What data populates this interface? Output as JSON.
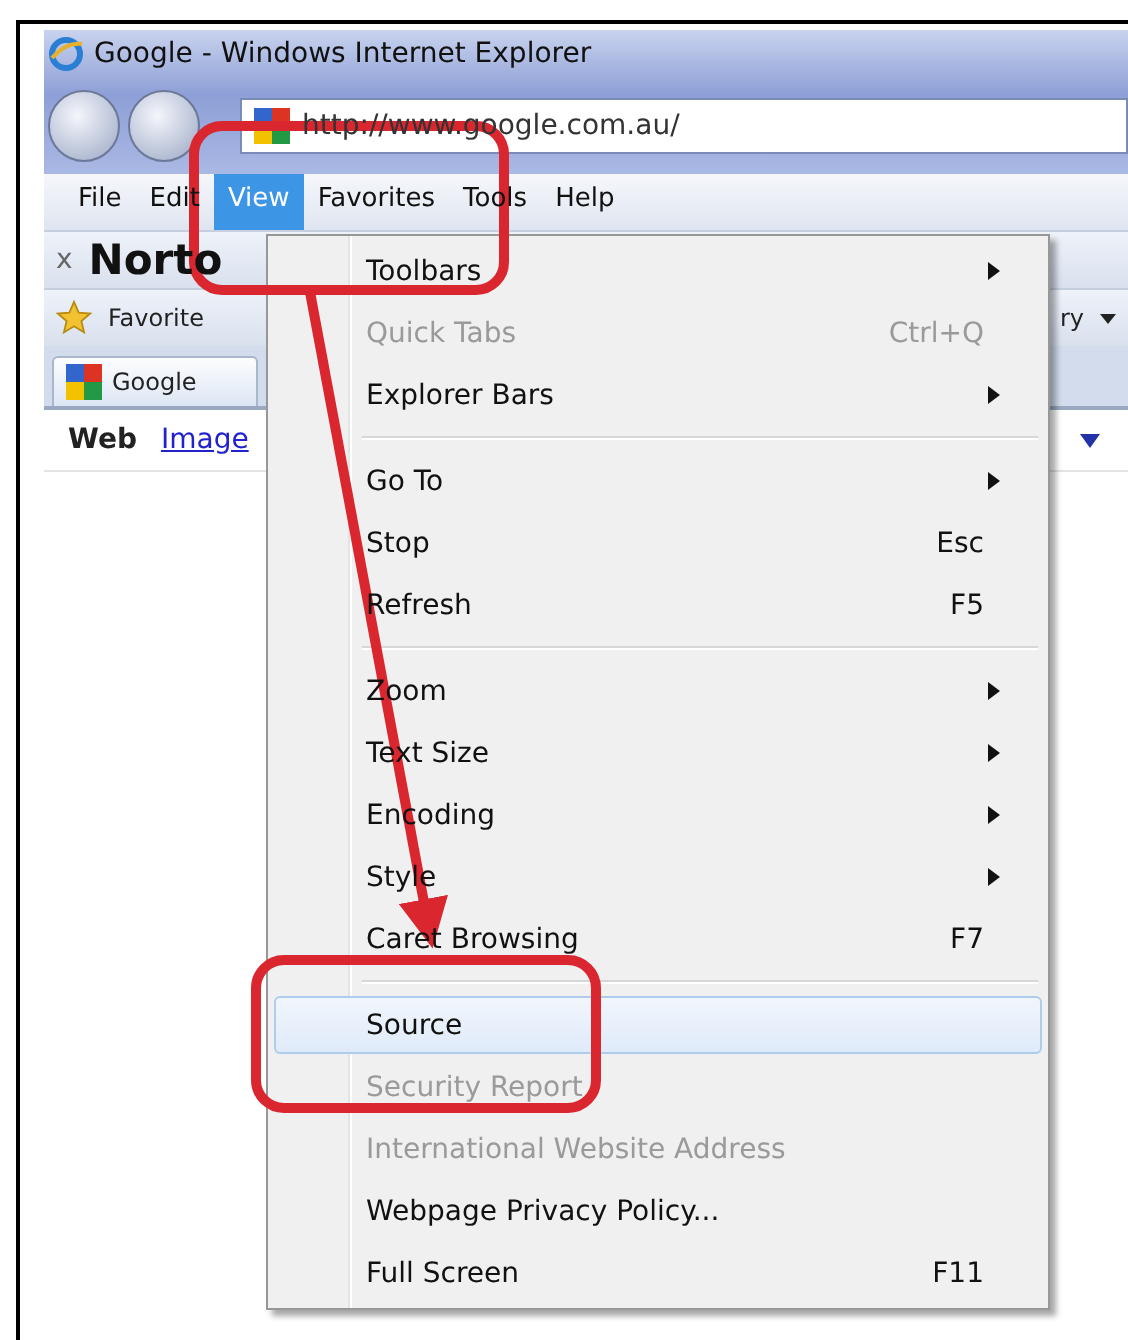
{
  "window": {
    "title": "Google - Windows Internet Explorer"
  },
  "address_bar": {
    "url": "http://www.google.com.au/"
  },
  "menu_bar": [
    {
      "label": "File",
      "selected": false
    },
    {
      "label": "Edit",
      "selected": false
    },
    {
      "label": "View",
      "selected": true
    },
    {
      "label": "Favorites",
      "selected": false
    },
    {
      "label": "Tools",
      "selected": false
    },
    {
      "label": "Help",
      "selected": false
    }
  ],
  "norton_toolbar": {
    "close": "x",
    "title": "Norto"
  },
  "favorites_bar": {
    "favorites": "Favorite",
    "right_text": "ry"
  },
  "tab": {
    "title": "Google"
  },
  "page": {
    "links": [
      {
        "label": "Web",
        "kind": "current"
      },
      {
        "label": "Image",
        "kind": "link"
      }
    ]
  },
  "view_menu": [
    {
      "kind": "item",
      "label": "Toolbars",
      "submenu": true,
      "disabled": false,
      "selected": false
    },
    {
      "kind": "item",
      "label": "Quick Tabs",
      "shortcut": "Ctrl+Q",
      "submenu": false,
      "disabled": true,
      "selected": false
    },
    {
      "kind": "item",
      "label": "Explorer Bars",
      "submenu": true,
      "disabled": false,
      "selected": false
    },
    {
      "kind": "separator"
    },
    {
      "kind": "item",
      "label": "Go To",
      "submenu": true,
      "disabled": false,
      "selected": false
    },
    {
      "kind": "item",
      "label": "Stop",
      "shortcut": "Esc",
      "submenu": false,
      "disabled": false,
      "selected": false
    },
    {
      "kind": "item",
      "label": "Refresh",
      "shortcut": "F5",
      "submenu": false,
      "disabled": false,
      "selected": false
    },
    {
      "kind": "separator"
    },
    {
      "kind": "item",
      "label": "Zoom",
      "submenu": true,
      "disabled": false,
      "selected": false
    },
    {
      "kind": "item",
      "label": "Text Size",
      "submenu": true,
      "disabled": false,
      "selected": false
    },
    {
      "kind": "item",
      "label": "Encoding",
      "submenu": true,
      "disabled": false,
      "selected": false
    },
    {
      "kind": "item",
      "label": "Style",
      "submenu": true,
      "disabled": false,
      "selected": false
    },
    {
      "kind": "item",
      "label": "Caret Browsing",
      "shortcut": "F7",
      "submenu": false,
      "disabled": false,
      "selected": false
    },
    {
      "kind": "separator"
    },
    {
      "kind": "item",
      "label": "Source",
      "submenu": false,
      "disabled": false,
      "selected": true
    },
    {
      "kind": "item",
      "label": "Security Report",
      "submenu": false,
      "disabled": true,
      "selected": false
    },
    {
      "kind": "item",
      "label": "International Website Address",
      "submenu": false,
      "disabled": true,
      "selected": false
    },
    {
      "kind": "item",
      "label": "Webpage Privacy Policy...",
      "submenu": false,
      "disabled": false,
      "selected": false
    },
    {
      "kind": "item",
      "label": "Full Screen",
      "shortcut": "F11",
      "submenu": false,
      "disabled": false,
      "selected": false
    }
  ]
}
